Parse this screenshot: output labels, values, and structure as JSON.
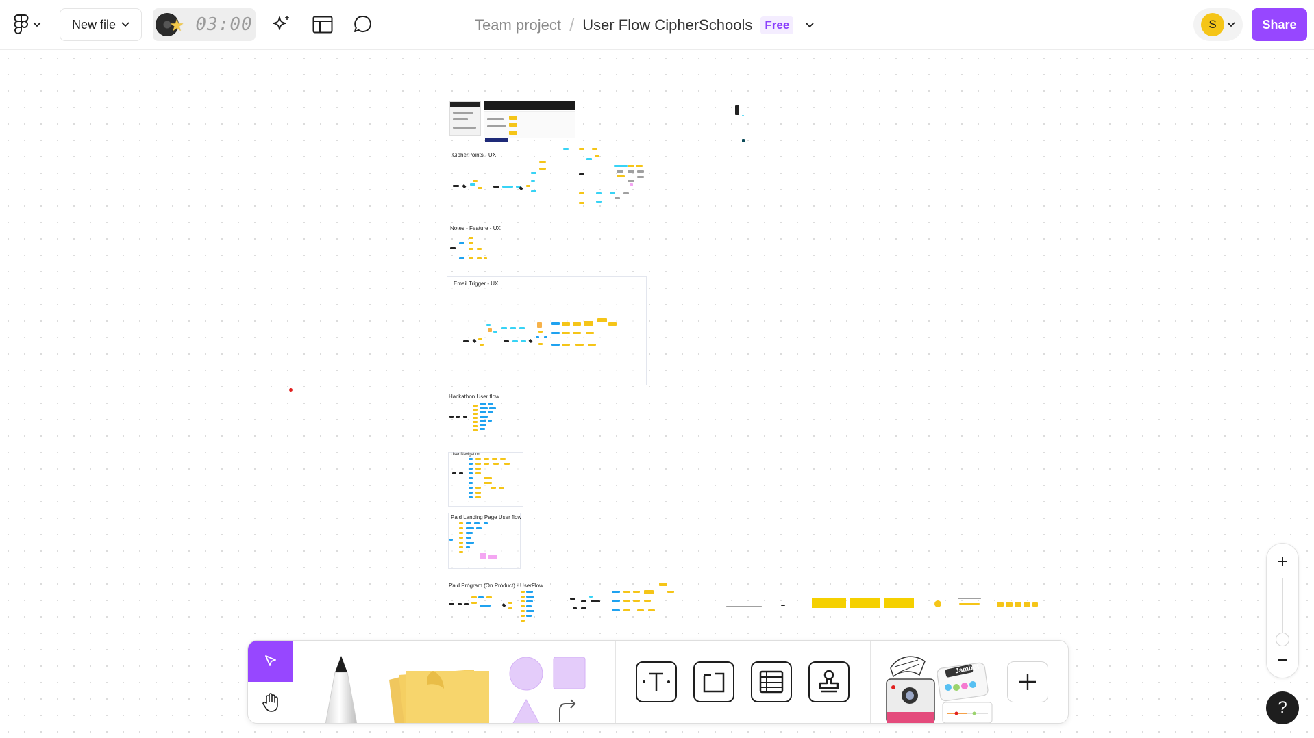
{
  "header": {
    "new_file_label": "New file",
    "timer_text": "03:00",
    "breadcrumb": {
      "team": "Team project",
      "separator": "/",
      "file": "User Flow CipherSchools",
      "plan_badge": "Free"
    },
    "avatar_initial": "S",
    "share_label": "Share"
  },
  "canvas": {
    "sections": [
      "CipherPoints - UX",
      "Notes - Feature - UX",
      "Email Trigger - UX",
      "Hackathon User flow",
      "User Navigation",
      "Paid Landing Page User flow",
      "Paid Program (On Product) - UserFlow"
    ],
    "sticker_text": "Jambot"
  },
  "zoom": {
    "in_symbol": "+",
    "out_symbol": "−"
  },
  "help_symbol": "?",
  "colors": {
    "accent": "#9747ff",
    "sticky_yellow": "#f5c518",
    "flow_blue": "#1fa2f0",
    "marker_red": "#e1201f"
  },
  "toolbar": {
    "tools": [
      "select-icon",
      "hand-icon",
      "pencil-icon",
      "sticky-note-icon",
      "shapes-icon",
      "connector-icon",
      "text-icon",
      "section-icon",
      "table-icon",
      "stamp-icon",
      "widgets-icon",
      "plus-icon"
    ]
  }
}
